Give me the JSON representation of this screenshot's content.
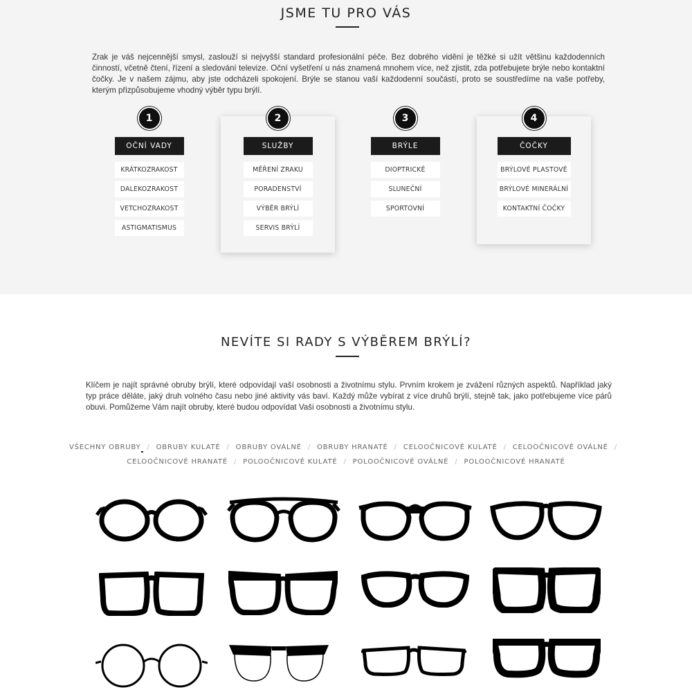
{
  "top": {
    "title": "JSME TU PRO VÁS",
    "intro": "Zrak je váš nejcennější smysl, zaslouží si nejvyšší standard profesionální péče. Bez dobrého vidění je těžké si užít většinu každodenních činností, včetně čtení, řízení a sledování televize. Oční vyšetření u nás znamená mnohem více, než zjistit, zda potřebujete brýle nebo kontaktní čočky. Je v našem zájmu, aby jste odcházeli spokojení. Brýle se stanou vaší každodenní součástí, proto se soustředíme na vaše potřeby, kterým přizpůsobujeme vhodný výběr typu brýlí.",
    "cards": [
      {
        "number": "1",
        "title": "OČNÍ VADY",
        "items": [
          "KRÁTKOZRAKOST",
          "DALEKOZRAKOST",
          "VETCHOZRAKOST",
          "ASTIGMATISMUS"
        ]
      },
      {
        "number": "2",
        "title": "SLUŽBY",
        "items": [
          "MĚŘENÍ ZRAKU",
          "PORADENSTVÍ",
          "VÝBĚR BRÝLÍ",
          "SERVIS BRÝLÍ"
        ]
      },
      {
        "number": "3",
        "title": "BRÝLE",
        "items": [
          "DIOPTRICKÉ",
          "SLUNEČNÍ",
          "SPORTOVNÍ"
        ]
      },
      {
        "number": "4",
        "title": "ČOČKY",
        "items": [
          "BRÝLOVÉ PLASTOVÉ",
          "BRÝLOVÉ MINERÁLNÍ",
          "KONTAKTNÍ ČOČKY"
        ]
      }
    ]
  },
  "advice": {
    "title": "NEVÍTE SI RADY S VÝBĚREM BRÝLÍ?",
    "intro": "Klíčem je najít správné obruby brýlí, které odpovídají vaší osobnosti a životnímu stylu. Prvním krokem je zvážení různých aspektů. Například jaký typ práce děláte, jaký druh volného času nebo jiné aktivity vás baví. Každý může vybírat z více druhů brýlí, stejně tak, jako potřebujeme více párů obuvi. Pomůžeme Vám najít obruby, které budou odpovídat Vaši osobnosti a životnímu stylu.",
    "filters_row1": [
      "VŠECHNY OBRUBY",
      "OBRUBY KULATÉ",
      "OBRUBY OVÁLNÉ",
      "OBRUBY HRANATÉ",
      "CELOOČNICOVÉ KULATÉ",
      "CELOOČNICOVÉ OVÁLNÉ"
    ],
    "filters_row2": [
      "CELOOČNICOVÉ HRANATÉ",
      "POLOOČNICOVÉ KULATÉ",
      "POLOOČNICOVÉ OVÁLNÉ",
      "POLOOČNICOVÉ HRANATÉ"
    ],
    "separator": "/",
    "active_filter": "VŠECHNY OBRUBY",
    "glasses": [
      "round-thick-glasses-icon",
      "aviator-round-glasses-icon",
      "keyhole-round-glasses-icon",
      "cat-eye-thin-glasses-icon",
      "square-thick-glasses-icon",
      "wayfarer-glasses-icon",
      "cat-eye-thick-glasses-icon",
      "bold-square-glasses-icon",
      "round-wire-glasses-icon",
      "browline-glasses-icon",
      "rectangle-glasses-icon",
      "thick-rectangle-glasses-icon"
    ]
  }
}
